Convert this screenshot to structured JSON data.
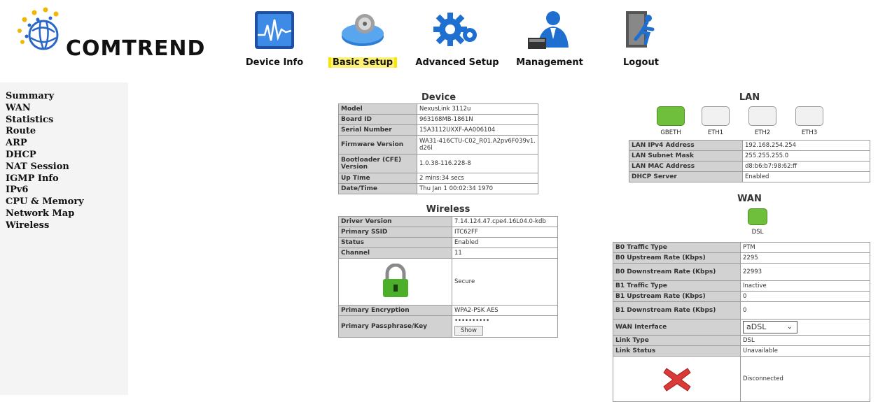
{
  "brand": {
    "name": "COMTREND"
  },
  "nav": [
    {
      "label": "Device Info",
      "icon": "device-info-icon"
    },
    {
      "label": "Basic Setup",
      "icon": "basic-setup-icon"
    },
    {
      "label": "Advanced Setup",
      "icon": "advanced-setup-icon"
    },
    {
      "label": "Management",
      "icon": "management-icon"
    },
    {
      "label": "Logout",
      "icon": "logout-icon"
    }
  ],
  "sidebar": {
    "items": [
      "Summary",
      "WAN",
      "Statistics",
      "Route",
      "ARP",
      "DHCP",
      "NAT Session",
      "IGMP Info",
      "IPv6",
      "CPU & Memory",
      "Network Map",
      "Wireless"
    ]
  },
  "device": {
    "title": "Device",
    "rows": [
      [
        "Model",
        "NexusLink 3112u"
      ],
      [
        "Board ID",
        "963168MB-1861N"
      ],
      [
        "Serial Number",
        "15A3112UXXF-AA006104"
      ],
      [
        "Firmware Version",
        "WA31-416CTU-C02_R01.A2pv6F039v1.d26l"
      ],
      [
        "Bootloader (CFE) Version",
        "1.0.38-116.228-8"
      ],
      [
        "Up Time",
        "2 mins:34 secs"
      ],
      [
        "Date/Time",
        "Thu Jan 1 00:02:34 1970"
      ]
    ]
  },
  "wireless": {
    "title": "Wireless",
    "driver_label": "Driver Version",
    "driver_value": "7.14.124.47.cpe4.16L04.0-kdb",
    "ssid_label": "Primary SSID",
    "ssid_value": "ITC62FF",
    "status_label": "Status",
    "status_value": "Enabled",
    "channel_label": "Channel",
    "channel_value": "11",
    "security_value": "Secure",
    "encryption_label": "Primary Encryption",
    "encryption_value": "WPA2-PSK AES",
    "pass_label": "Primary Passphrase/Key",
    "pass_value": "••••••••••",
    "show_label": "Show"
  },
  "lan": {
    "title": "LAN",
    "ports": [
      {
        "label": "GBETH",
        "active": true
      },
      {
        "label": "ETH1",
        "active": false
      },
      {
        "label": "ETH2",
        "active": false
      },
      {
        "label": "ETH3",
        "active": false
      }
    ],
    "rows": [
      [
        "LAN IPv4 Address",
        "192.168.254.254"
      ],
      [
        "LAN Subnet Mask",
        "255.255.255.0"
      ],
      [
        "LAN MAC Address",
        "d8:b6:b7:98:62:ff"
      ],
      [
        "DHCP Server",
        "Enabled"
      ]
    ]
  },
  "wan": {
    "title": "WAN",
    "port": {
      "label": "DSL",
      "active": true
    },
    "rows_top": [
      [
        "B0 Traffic Type",
        "PTM"
      ],
      [
        "B0 Upstream Rate (Kbps)",
        "2295"
      ],
      [
        "B0 Downstream Rate (Kbps)",
        "22993"
      ],
      [
        "B1 Traffic Type",
        "Inactive"
      ],
      [
        "B1 Upstream Rate (Kbps)",
        "0"
      ],
      [
        "B1 Downstream Rate (Kbps)",
        "0"
      ]
    ],
    "interface_label": "WAN Interface",
    "interface_value": "aDSL",
    "rows_bottom": [
      [
        "Link Type",
        "DSL"
      ],
      [
        "Link Status",
        "Unavailable"
      ]
    ],
    "connection_value": "Disconnected"
  },
  "colors": {
    "active_port": "#6fbf3d",
    "key_cell": "#d2d2d2",
    "sidebar_bg": "#f4f4f4",
    "highlight": "#f7e600"
  }
}
